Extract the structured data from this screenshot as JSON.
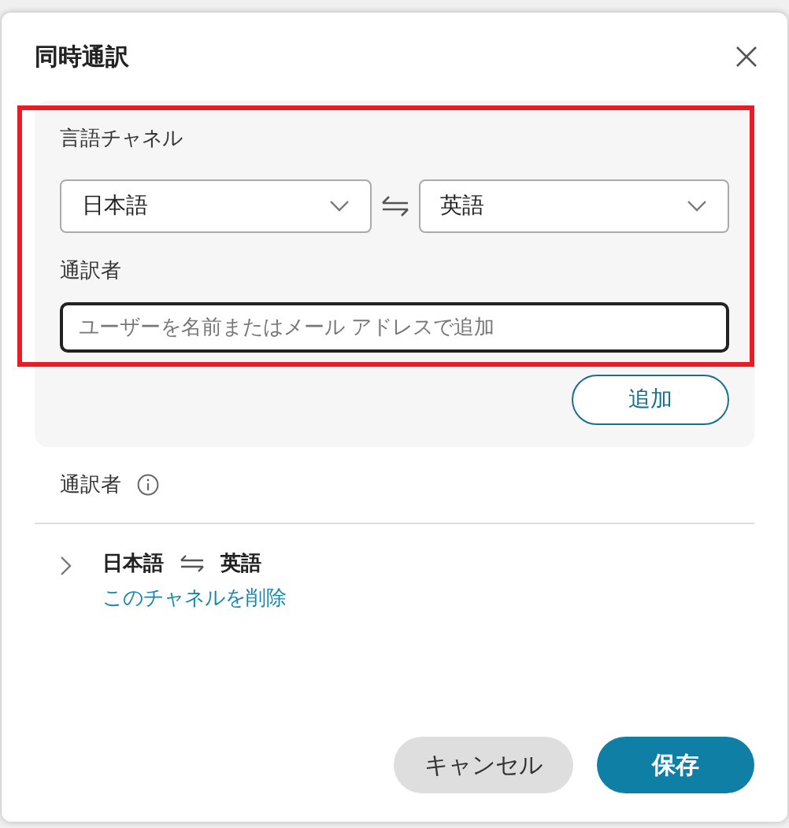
{
  "dialog": {
    "title": "同時通訳"
  },
  "channel_form": {
    "highlighted": true,
    "channel_label": "言語チャネル",
    "source_language": "日本語",
    "target_language": "英語",
    "interpreter_label": "通訳者",
    "interpreter_field": {
      "placeholder": "ユーザーを名前またはメール アドレスで追加"
    },
    "add_button": "追加"
  },
  "interpreters": {
    "heading": "通訳者",
    "channels": [
      {
        "source": "日本語",
        "target": "英語",
        "expanded": false,
        "remove_link": "このチャネルを削除"
      }
    ]
  },
  "buttons": [
    {
      "kind": "secondary",
      "label": "キャンセル"
    },
    {
      "kind": "primary",
      "label": "保存"
    }
  ]
}
